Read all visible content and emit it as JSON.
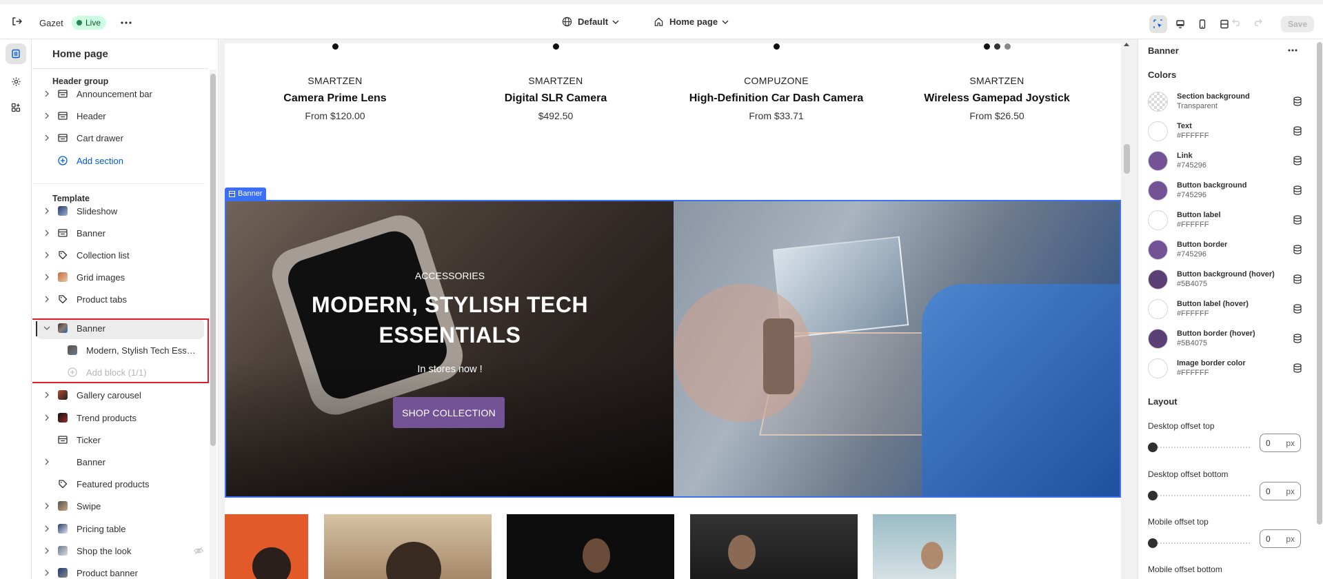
{
  "topbar": {
    "store_name": "Gazet",
    "status": "Live",
    "theme": "Default",
    "page": "Home page",
    "save_label": "Save"
  },
  "icons": {
    "exit": "exit-icon",
    "more": "more-horizontal-icon",
    "globe": "globe-icon",
    "home": "home-icon",
    "inspector": "inspector-icon",
    "desktop": "desktop-icon",
    "mobile": "mobile-icon",
    "fullwidth": "fullwidth-icon",
    "undo": "undo-icon",
    "redo": "redo-icon",
    "sections": "sections-icon",
    "settings": "gear-icon",
    "apps": "apps-icon"
  },
  "left_panel": {
    "title": "Home page",
    "header_group_title": "Header group",
    "header_items": [
      {
        "label": "Announcement bar",
        "icon": "section-icon"
      },
      {
        "label": "Header",
        "icon": "section-icon"
      },
      {
        "label": "Cart drawer",
        "icon": "section-icon"
      }
    ],
    "add_section": "Add section",
    "template_title": "Template",
    "template_items": [
      {
        "label": "Slideshow",
        "icon": "image-thumb"
      },
      {
        "label": "Banner",
        "icon": "section-icon"
      },
      {
        "label": "Collection list",
        "icon": "tag-icon"
      },
      {
        "label": "Grid images",
        "icon": "image-thumb"
      },
      {
        "label": "Product tabs",
        "icon": "tag-icon"
      },
      {
        "label": "Banner",
        "icon": "image-thumb"
      },
      {
        "label": "Modern, Stylish Tech Esse...",
        "icon": "image-thumb"
      },
      {
        "label": "Add block (1/1)",
        "icon": "plus-circle-icon"
      },
      {
        "label": "Gallery carousel",
        "icon": "image-thumb"
      },
      {
        "label": "Trend products",
        "icon": "image-thumb"
      },
      {
        "label": "Ticker",
        "icon": "section-icon"
      },
      {
        "label": "Banner",
        "icon": "image-thumb"
      },
      {
        "label": "Featured products",
        "icon": "tag-icon"
      },
      {
        "label": "Swipe",
        "icon": "image-thumb"
      },
      {
        "label": "Pricing table",
        "icon": "image-thumb"
      },
      {
        "label": "Shop the look",
        "icon": "image-thumb"
      },
      {
        "label": "Product banner",
        "icon": "image-thumb"
      }
    ]
  },
  "preview": {
    "products": [
      {
        "vendor": "SMARTZEN",
        "name": "Camera Prime Lens",
        "price": "From $120.00"
      },
      {
        "vendor": "SMARTZEN",
        "name": "Digital SLR Camera",
        "price": "$492.50"
      },
      {
        "vendor": "COMPUZONE",
        "name": "High-Definition Car Dash Camera",
        "price": "From $33.71"
      },
      {
        "vendor": "SMARTZEN",
        "name": "Wireless Gamepad Joystick",
        "price": "From $26.50"
      }
    ],
    "banner_tag": "Banner",
    "banner": {
      "kicker": "ACCESSORIES",
      "heading": "MODERN, STYLISH TECH ESSENTIALS",
      "subheading": "In stores now !",
      "button": "SHOP COLLECTION"
    }
  },
  "right_panel": {
    "title": "Banner",
    "colors_title": "Colors",
    "colors": [
      {
        "label": "Section background",
        "value": "Transparent",
        "hex": "transparent"
      },
      {
        "label": "Text",
        "value": "#FFFFFF",
        "hex": "#FFFFFF"
      },
      {
        "label": "Link",
        "value": "#745296",
        "hex": "#745296"
      },
      {
        "label": "Button background",
        "value": "#745296",
        "hex": "#745296"
      },
      {
        "label": "Button label",
        "value": "#FFFFFF",
        "hex": "#FFFFFF"
      },
      {
        "label": "Button border",
        "value": "#745296",
        "hex": "#745296"
      },
      {
        "label": "Button background (hover)",
        "value": "#5B4075",
        "hex": "#5B4075"
      },
      {
        "label": "Button label (hover)",
        "value": "#FFFFFF",
        "hex": "#FFFFFF"
      },
      {
        "label": "Button border (hover)",
        "value": "#5B4075",
        "hex": "#5B4075"
      },
      {
        "label": "Image border color",
        "value": "#FFFFFF",
        "hex": "#FFFFFF"
      }
    ],
    "layout_title": "Layout",
    "offsets": [
      {
        "label": "Desktop offset top",
        "value": "0",
        "unit": "px"
      },
      {
        "label": "Desktop offset bottom",
        "value": "0",
        "unit": "px"
      },
      {
        "label": "Mobile offset top",
        "value": "0",
        "unit": "px"
      },
      {
        "label": "Mobile offset bottom",
        "value": "",
        "unit": ""
      }
    ]
  }
}
